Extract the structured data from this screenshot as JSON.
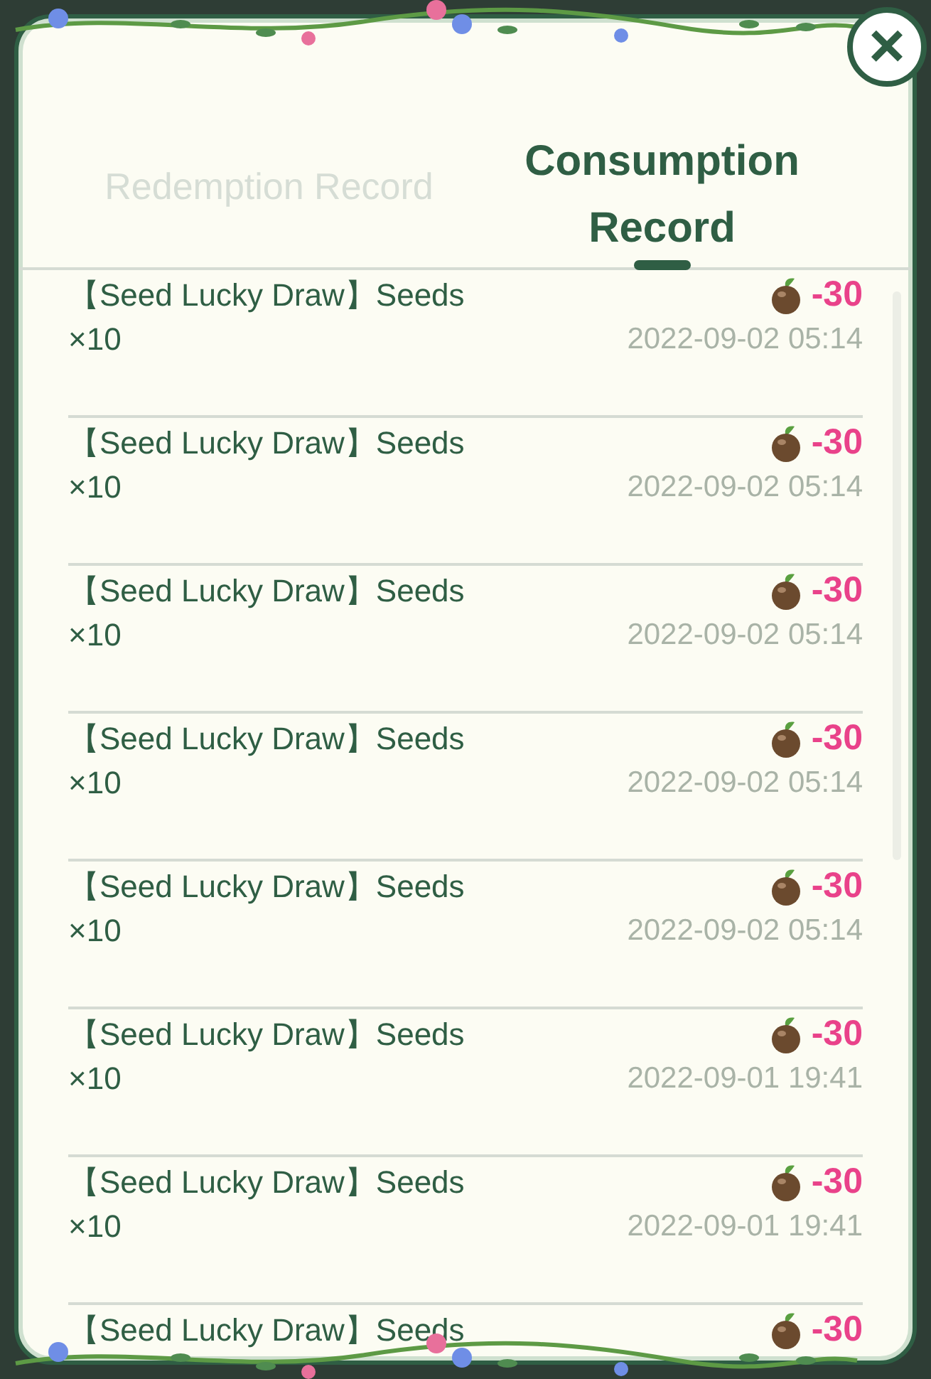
{
  "tabs": [
    {
      "label": "Redemption Record",
      "selected": false
    },
    {
      "label": "Consumption Record",
      "selected": true
    }
  ],
  "close": {
    "label": "×"
  },
  "records": [
    {
      "title": "【Seed Lucky Draw】Seeds ×10",
      "amount": "-30",
      "time": "2022-09-02 05:14"
    },
    {
      "title": "【Seed Lucky Draw】Seeds ×10",
      "amount": "-30",
      "time": "2022-09-02 05:14"
    },
    {
      "title": "【Seed Lucky Draw】Seeds ×10",
      "amount": "-30",
      "time": "2022-09-02 05:14"
    },
    {
      "title": "【Seed Lucky Draw】Seeds ×10",
      "amount": "-30",
      "time": "2022-09-02 05:14"
    },
    {
      "title": "【Seed Lucky Draw】Seeds ×10",
      "amount": "-30",
      "time": "2022-09-02 05:14"
    },
    {
      "title": "【Seed Lucky Draw】Seeds ×10",
      "amount": "-30",
      "time": "2022-09-01 19:41"
    },
    {
      "title": "【Seed Lucky Draw】Seeds ×10",
      "amount": "-30",
      "time": "2022-09-01 19:41"
    },
    {
      "title": "【Seed Lucky Draw】Seeds",
      "amount": "-30"
    }
  ]
}
